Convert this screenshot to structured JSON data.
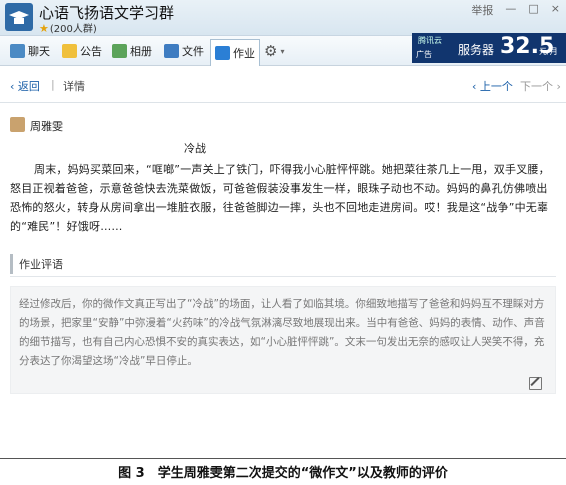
{
  "group": {
    "title": "心语飞扬语文学习群",
    "meta": "(200人群)",
    "window_controls": [
      "举报",
      "—",
      "□",
      "×"
    ]
  },
  "tabs": [
    {
      "label": "聊天",
      "icon": "chat-icon"
    },
    {
      "label": "公告",
      "icon": "announcement-icon"
    },
    {
      "label": "相册",
      "icon": "photo-icon"
    },
    {
      "label": "文件",
      "icon": "folder-icon"
    },
    {
      "label": "作业",
      "icon": "homework-icon",
      "active": true
    }
  ],
  "ad": {
    "brand": "腾讯云",
    "tag": "广告",
    "label": "服务器",
    "price": "32.5",
    "unit": "元/月"
  },
  "nav": {
    "back": "返回",
    "crumb": "详情",
    "prev": "上一个",
    "next": "下一个"
  },
  "submission": {
    "student": "周雅雯",
    "essay_title": "冷战",
    "essay_body": "周末，妈妈买菜回来，“哐啷”一声关上了铁门，吓得我小心脏怦怦跳。她把菜往茶几上一甩，双手叉腰，怒目正视着爸爸，示意爸爸快去洗菜做饭，可爸爸假装没事发生一样，眼珠子动也不动。妈妈的鼻孔仿佛喷出恐怖的怒火，转身从房间拿出一堆脏衣服，往爸爸脚边一摔，头也不回地走进房间。哎！我是这“战争”中无辜的“难民”！好饿呀……"
  },
  "comment": {
    "heading": "作业评语",
    "text": "经过修改后，你的微作文真正写出了“冷战”的场面，让人看了如临其境。你细致地描写了爸爸和妈妈互不理睬对方的场景，把家里“安静”中弥漫着“火药味”的冷战气氛淋漓尽致地展现出来。当中有爸爸、妈妈的表情、动作、声音的细节描写，也有自己内心恐惧不安的真实表达，如“小心脏怦怦跳”。文末一句发出无奈的感叹让人哭笑不得，充分表达了你渴望这场“冷战”早日停止。"
  },
  "caption": "图 3　学生周雅雯第二次提交的“微作文”以及教师的评价"
}
